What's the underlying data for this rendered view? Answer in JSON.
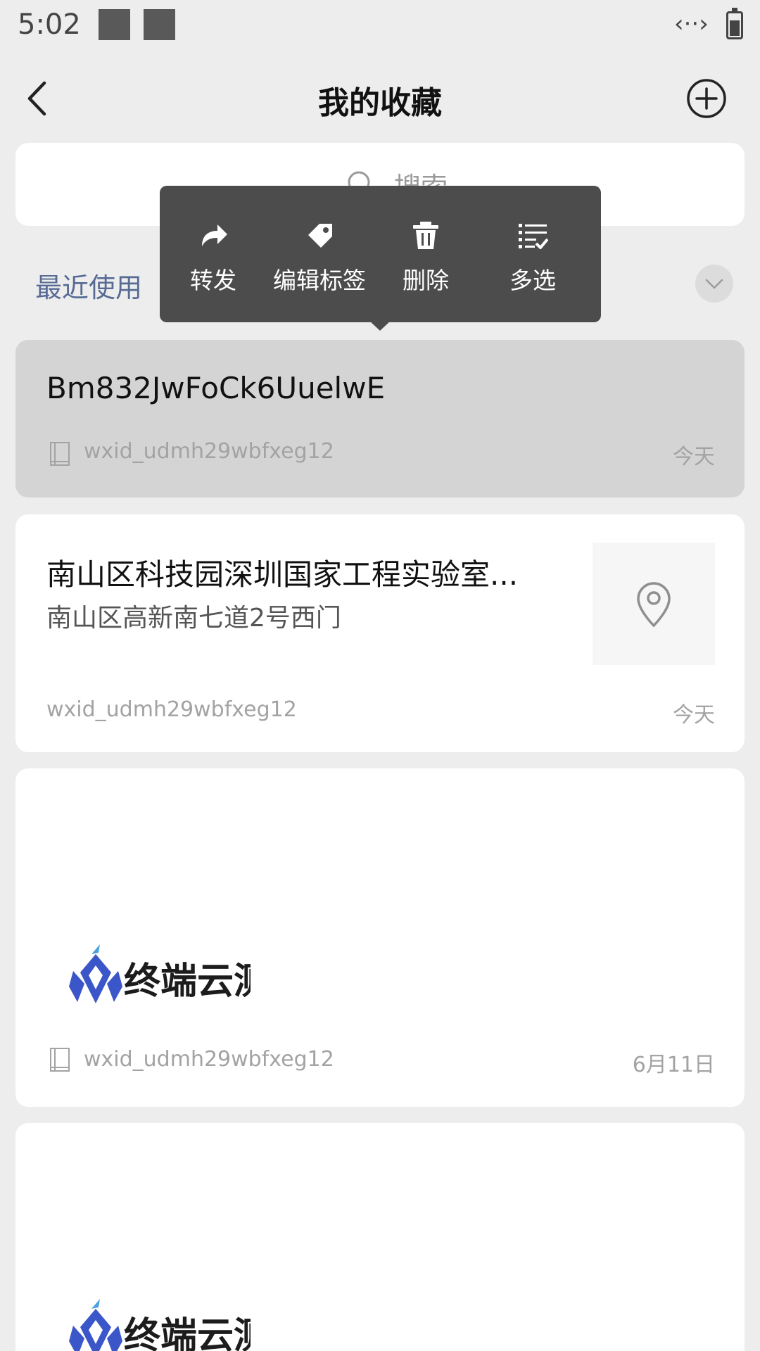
{
  "status_bar": {
    "time": "5:02",
    "link_glyph": "‹··›"
  },
  "nav": {
    "title": "我的收藏"
  },
  "search": {
    "placeholder": "搜索"
  },
  "filter": {
    "recent_label": "最近使用"
  },
  "context_menu": {
    "items": [
      {
        "label": "转发",
        "icon": "forward-icon"
      },
      {
        "label": "编辑标签",
        "icon": "tag-icon"
      },
      {
        "label": "删除",
        "icon": "trash-icon"
      },
      {
        "label": "多选",
        "icon": "multi-select-icon"
      }
    ]
  },
  "favorites": [
    {
      "type": "note",
      "title": "Bm832JwFoCk6UuelwE",
      "source": "wxid_udmh29wbfxeg12",
      "date": "今天"
    },
    {
      "type": "location",
      "title": "南山区科技园深圳国家工程实验室...",
      "subtitle": "南山区高新南七道2号西门",
      "source": "wxid_udmh29wbfxeg12",
      "date": "今天"
    },
    {
      "type": "image-note",
      "logo_text": "终端云测",
      "source": "wxid_udmh29wbfxeg12",
      "date": "6月11日"
    },
    {
      "type": "image-note",
      "logo_text": "终端云测"
    }
  ],
  "colors": {
    "accent_link": "#576b95",
    "popup_bg": "#4c4c4c",
    "selected_card": "#d4d4d4",
    "page_bg": "#ededed"
  }
}
